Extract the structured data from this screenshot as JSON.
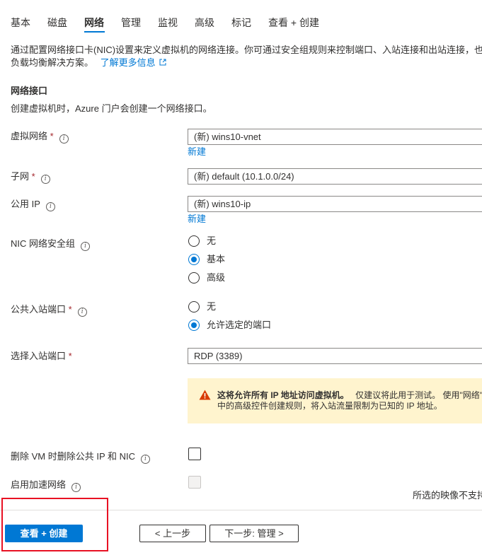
{
  "tabs": [
    {
      "label": "基本",
      "active": false
    },
    {
      "label": "磁盘",
      "active": false
    },
    {
      "label": "网络",
      "active": true
    },
    {
      "label": "管理",
      "active": false
    },
    {
      "label": "监视",
      "active": false
    },
    {
      "label": "高级",
      "active": false
    },
    {
      "label": "标记",
      "active": false
    },
    {
      "label": "查看 + 创建",
      "active": false
    }
  ],
  "intro": {
    "line1": "通过配置网络接口卡(NIC)设置来定义虚拟机的网络连接。你可通过安全组规则来控制端口、入站连接和出站连接，也",
    "line2": "负载均衡解决方案。",
    "learn_more": "了解更多信息"
  },
  "section": {
    "title": "网络接口",
    "desc": "创建虚拟机时，Azure 门户会创建一个网络接口。"
  },
  "fields": {
    "vnet": {
      "label": "虚拟网络",
      "value": "(新) wins10-vnet",
      "create_link": "新建"
    },
    "subnet": {
      "label": "子网",
      "value": "(新) default (10.1.0.0/24)"
    },
    "public_ip": {
      "label": "公用 IP",
      "value": "(新) wins10-ip",
      "create_link": "新建"
    },
    "nsg": {
      "label": "NIC 网络安全组",
      "options": [
        "无",
        "基本",
        "高级"
      ],
      "selected": "基本"
    },
    "inbound": {
      "label": "公共入站端口",
      "options": [
        "无",
        "允许选定的端口"
      ],
      "selected": "允许选定的端口"
    },
    "ports": {
      "label": "选择入站端口",
      "value": "RDP (3389)"
    },
    "warning": {
      "bold": "这将允许所有 IP 地址访问虚拟机。",
      "rest": "仅建议将此用于测试。 使用\"网络\"",
      "line2": "中的高级控件创建规则，将入站流量限制为已知的 IP 地址。"
    },
    "delete_ip": {
      "label": "删除 VM 时删除公共 IP 和 NIC"
    },
    "accel": {
      "label": "启用加速网络",
      "note": "所选的映像不支持"
    }
  },
  "footer": {
    "review": "查看 + 创建",
    "prev": "< 上一步",
    "next": "下一步: 管理 >"
  },
  "colors": {
    "accent": "#0078d4",
    "required": "#a4262c",
    "warning_bg": "#fff4ce",
    "highlight_box": "#e81123"
  }
}
